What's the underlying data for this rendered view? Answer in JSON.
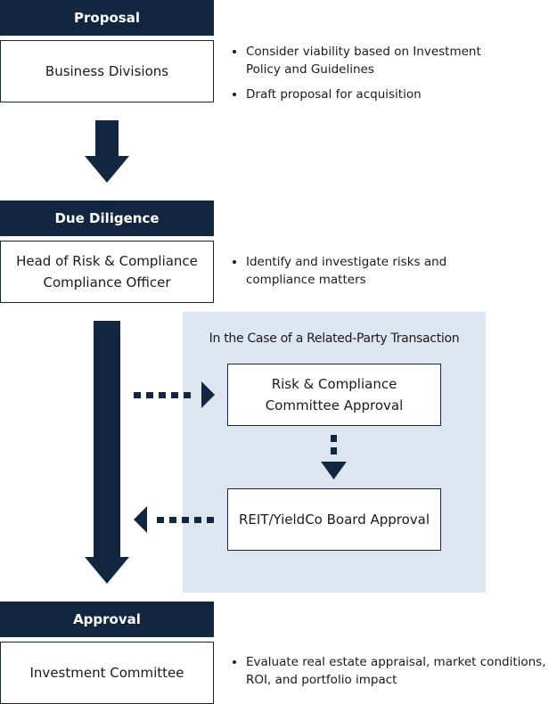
{
  "colors": {
    "navy": "#132640",
    "panel": "#dce5f0"
  },
  "stages": [
    {
      "header": "Proposal",
      "box": [
        "Business Divisions"
      ],
      "notes": [
        "Consider viability based on Investment Policy and Guidelines",
        "Draft proposal for acquisition"
      ]
    },
    {
      "header": "Due Diligence",
      "box": [
        "Head of Risk & Compliance",
        "Compliance Officer"
      ],
      "notes": [
        "Identify and investigate risks and compliance matters"
      ]
    },
    {
      "header": "Approval",
      "box": [
        "Investment Committee"
      ],
      "notes": [
        "Evaluate real estate appraisal, market conditions, ROI, and portfolio impact"
      ]
    }
  ],
  "related_party": {
    "title": "In the Case of a Related-Party Transaction",
    "steps": [
      [
        "Risk & Compliance",
        "Committee Approval"
      ],
      [
        "REIT/YieldCo Board Approval"
      ]
    ]
  }
}
